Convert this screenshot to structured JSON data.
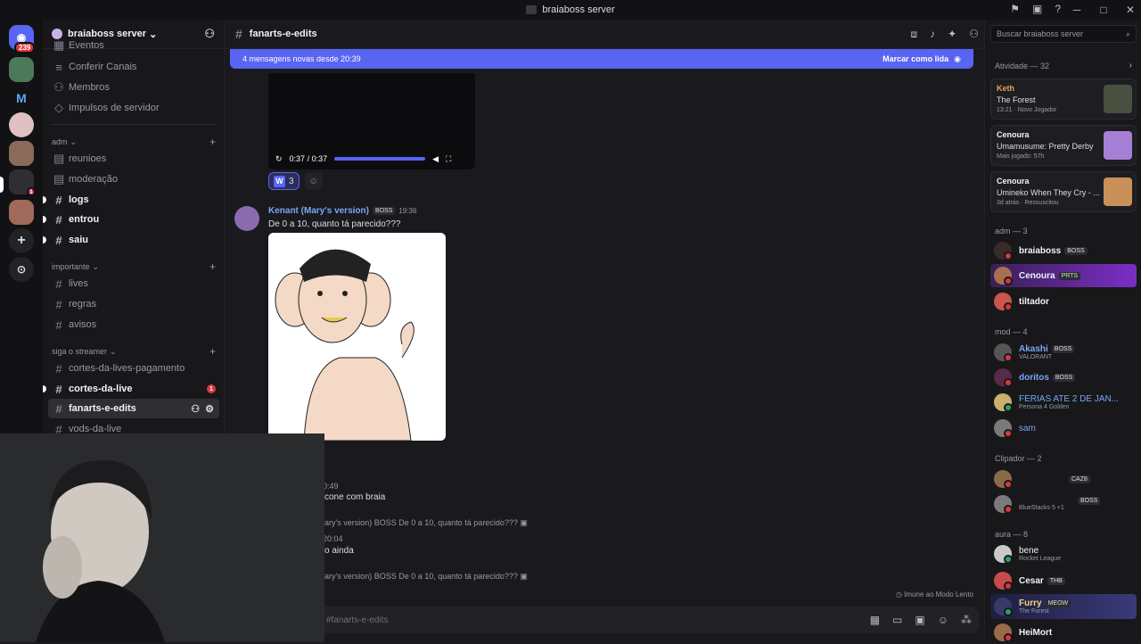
{
  "window": {
    "title": "braiaboss server"
  },
  "guilds": {
    "mention_badge": "239",
    "dm_label": "M"
  },
  "server": {
    "name": "braiaboss server"
  },
  "channel_list": {
    "top_items": [
      {
        "label": "Eventos",
        "icon": "calendar-icon"
      },
      {
        "label": "Conferir Canais",
        "icon": "list-icon"
      },
      {
        "label": "Membros",
        "icon": "members-icon"
      },
      {
        "label": "Impulsos de servidor",
        "icon": "boost-icon"
      }
    ],
    "categories": [
      {
        "name": "adm",
        "channels": [
          {
            "label": "reunioes",
            "icon": "forum-icon",
            "unread": false
          },
          {
            "label": "moderação",
            "icon": "forum-icon",
            "unread": false
          },
          {
            "label": "logs",
            "icon": "hash-icon",
            "unread": true
          },
          {
            "label": "entrou",
            "icon": "hash-icon",
            "unread": true
          },
          {
            "label": "saiu",
            "icon": "hash-icon",
            "unread": true
          }
        ]
      },
      {
        "name": "importante",
        "channels": [
          {
            "label": "lives",
            "icon": "hash-icon",
            "unread": false
          },
          {
            "label": "regras",
            "icon": "hash-icon",
            "unread": false
          },
          {
            "label": "avisos",
            "icon": "hash-icon",
            "unread": false
          }
        ]
      },
      {
        "name": "siga o streamer",
        "channels": [
          {
            "label": "cortes-da-lives-pagamento",
            "icon": "hash-icon",
            "unread": false
          },
          {
            "label": "cortes-da-live",
            "icon": "hash-icon",
            "unread": true,
            "badge": "1"
          },
          {
            "label": "fanarts-e-edits",
            "icon": "hash-icon",
            "active": true
          },
          {
            "label": "vods-da-live",
            "icon": "hash-icon",
            "unread": false
          }
        ]
      }
    ]
  },
  "chat": {
    "channel_name": "fanarts-e-edits",
    "banner_text": "4 mensagens novas desde 20:39",
    "banner_action": "Marcar como lida",
    "video_time": "0:37 / 0:37",
    "reaction_letter": "W",
    "reaction_count": "3",
    "message": {
      "author": "Kenant (Mary's version)",
      "tag": "BOSS",
      "time": "19:36",
      "text": "De 0 a 10, quanto tá parecido???"
    },
    "later": [
      {
        "text": "0:49",
        "dim": true
      },
      {
        "text": "cone com braia",
        "dim": false
      },
      {
        "text": "ary's version)  BOSS  De 0 a 10, quanto tá parecido??? ▣",
        "dim": true
      },
      {
        "text": "20:04",
        "dim": true
      },
      {
        "text": "o ainda",
        "dim": false
      },
      {
        "text": "ary's version)  BOSS  De 0 a 10, quanto tá parecido??? ▣",
        "dim": true
      }
    ],
    "slow_mode": "Imune ao Modo Lento",
    "composer_placeholder": "#fanarts-e-edits"
  },
  "members": {
    "search_placeholder": "Buscar braiaboss server",
    "activity_title": "Atividade — 32",
    "activities": [
      {
        "user": "Keth",
        "title": "The Forest",
        "meta": "13:21  ·  Novo Jogador",
        "thumb": "#4a5040"
      },
      {
        "user": "Cenoura",
        "title": "Umamusume: Pretty Derby",
        "meta": "Mais jogado: 57h",
        "thumb": "#a67fd6"
      },
      {
        "user": "Cenoura",
        "title": "Umineko When They Cry - ...",
        "meta": "3d atrás  ·  Ressuscitou",
        "thumb": "#c9905a"
      }
    ],
    "groups": [
      {
        "title": "adm — 3",
        "members": [
          {
            "name": "braiaboss",
            "tag": "BOSS",
            "color": "#3b2a2a"
          },
          {
            "name": "Cenoura",
            "tag": "PRTS",
            "color": "#a87050",
            "highlight": true
          },
          {
            "name": "tiltador",
            "color": "#c9564a"
          }
        ]
      },
      {
        "title": "mod — 4",
        "members": [
          {
            "name": "Akashi",
            "tag": "BOSS",
            "sub": "VALORANT",
            "color": "#555",
            "name_color": "#79a7f5"
          },
          {
            "name": "doritos",
            "tag": "BOSS",
            "color": "#5a2a4a",
            "name_color": "#79a7f5"
          },
          {
            "name": "FERIAS ATE 2 DE JAN...",
            "sub": "Persona 4 Golden",
            "color": "#c9b070",
            "name_color": "#79a7f5"
          },
          {
            "name": "sam",
            "color": "#7a7a7a",
            "name_color": "#79a7f5"
          }
        ]
      },
      {
        "title": "Clipador — 2",
        "members": [
          {
            "name": "",
            "tag": "CAZ8",
            "color": "#8a6a4a"
          },
          {
            "name": "",
            "tag": "BOSS",
            "sub": "BlueStacks 5 +1",
            "color": "#7a7a7a"
          }
        ]
      },
      {
        "title": "aura — 8",
        "members": [
          {
            "name": "bene",
            "sub": "Rocket League",
            "color": "#c9c9c9"
          },
          {
            "name": "Cesar",
            "tag": "THB",
            "color": "#c94a4a"
          },
          {
            "name": "Furry",
            "tag": "MEOW",
            "sub": "The Forest",
            "color": "#3a3a6a",
            "highlight": true,
            "name_color": "#f5d76e"
          },
          {
            "name": "HeiMort",
            "color": "#9a6a4a"
          }
        ]
      }
    ]
  }
}
